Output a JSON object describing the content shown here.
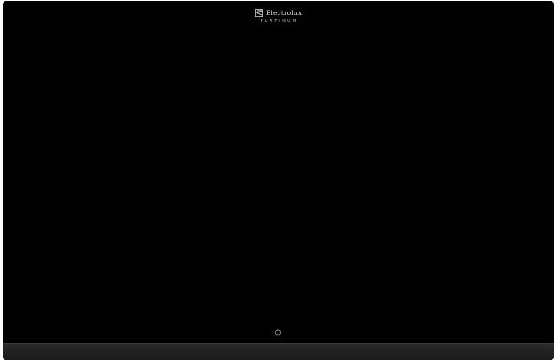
{
  "appliance": {
    "brand_name": "Electrolux",
    "sub_brand": "PLATINUM",
    "logo_icon": "electrolux-logo-icon",
    "power_icon": "power-icon"
  },
  "colors": {
    "glass": "#000000",
    "trim": "#222222",
    "text": "#e8e8e8"
  }
}
